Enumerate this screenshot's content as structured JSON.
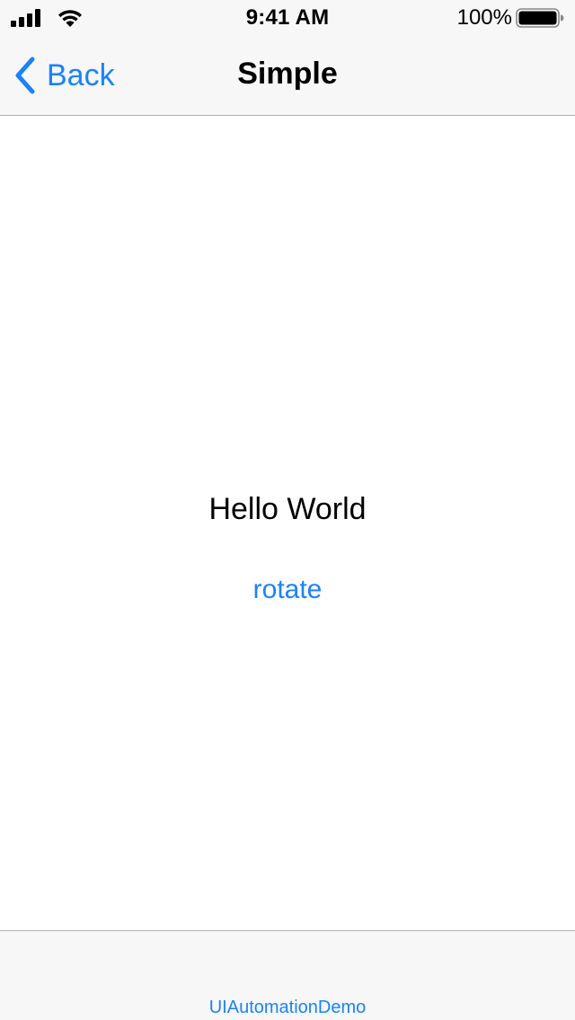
{
  "status_bar": {
    "time": "9:41 AM",
    "battery_percent": "100%",
    "signal_icon": "cellular-signal-icon",
    "wifi_icon": "wifi-icon",
    "battery_icon": "battery-full-icon",
    "battery_level": 1.0
  },
  "nav": {
    "back_label": "Back",
    "back_icon": "chevron-left-icon",
    "title": "Simple"
  },
  "content": {
    "hello_text": "Hello World",
    "rotate_label": "rotate"
  },
  "bottom_bar": {
    "label": "UIAutomationDemo"
  },
  "colors": {
    "accent": "#1a82fb",
    "bar_background": "#f7f7f7",
    "separator": "#b2b2b2"
  }
}
